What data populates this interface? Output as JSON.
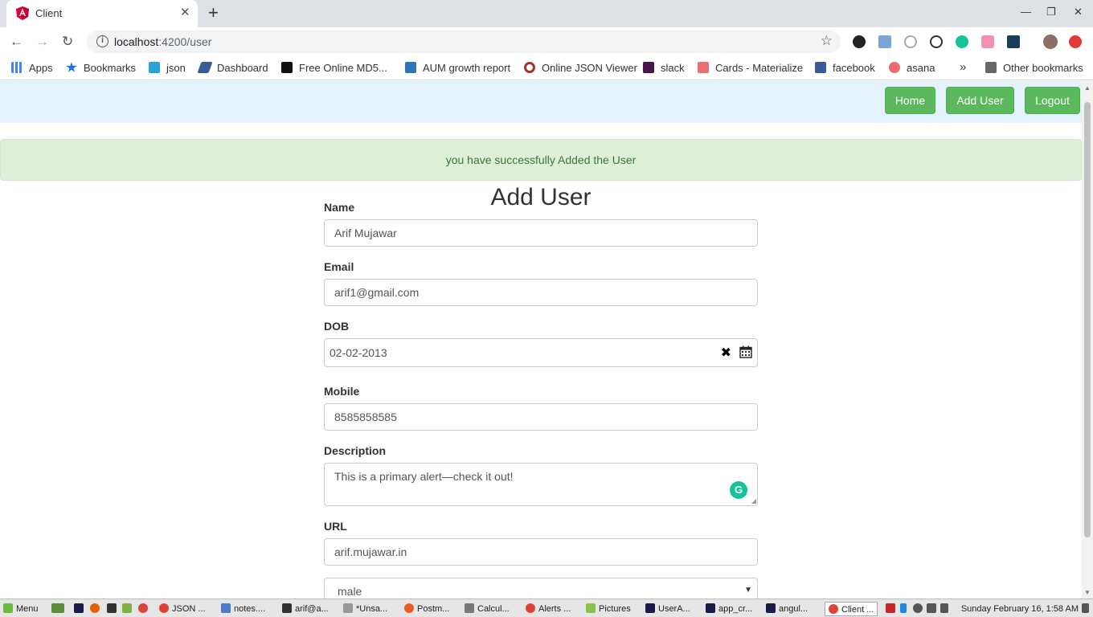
{
  "browser": {
    "tab_title": "Client",
    "tab_close": "✕",
    "new_tab": "+",
    "url_host": "localhost",
    "url_path": ":4200/user",
    "window_controls": {
      "minimize": "—",
      "restore": "❐",
      "close": "✕"
    },
    "nav": {
      "back": "←",
      "forward": "→",
      "reload": "↻"
    },
    "star": "☆",
    "bookmarks": [
      {
        "label": "Apps",
        "color": "#4285f4"
      },
      {
        "label": "Bookmarks",
        "color": "#1a73e8"
      },
      {
        "label": "json",
        "color": "#29a3d8"
      },
      {
        "label": "Dashboard",
        "color": "#3a5a9a"
      },
      {
        "label": "Free Online MD5...",
        "color": "#111111"
      },
      {
        "label": "AUM growth report",
        "color": "#2e75b6"
      },
      {
        "label": "Online JSON Viewer",
        "color": "#a33333"
      },
      {
        "label": "slack",
        "color": "#4a154b"
      },
      {
        "label": "Cards - Materialize",
        "color": "#ee6e73"
      },
      {
        "label": "facebook",
        "color": "#3b5998"
      },
      {
        "label": "asana",
        "color": "#f06a6a"
      }
    ],
    "bookmarks_more": "»",
    "other_bookmarks": "Other bookmarks"
  },
  "navbar": {
    "home": "Home",
    "add_user": "Add User",
    "logout": "Logout",
    "bg_color": "#e3f2fd",
    "button_color": "#5cb85c"
  },
  "alert": {
    "message": "you have successfully Added the User",
    "color": "#3c763d"
  },
  "form": {
    "title": "Add User",
    "name_label": "Name",
    "name_value": "Arif Mujawar",
    "email_label": "Email",
    "email_value": "arif1@gmail.com",
    "dob_label": "DOB",
    "dob_value": "02-02-2013",
    "dob_clear": "✖",
    "mobile_label": "Mobile",
    "mobile_value": "8585858585",
    "description_label": "Description",
    "description_value": "This is a primary alert—check it out!",
    "url_label": "URL",
    "url_value": "arif.mujawar.in",
    "gender_value": "male",
    "grammarly_glyph": "G"
  },
  "taskbar": {
    "menu": "Menu",
    "items": [
      "JSON ...",
      "notes....",
      "arif@a...",
      "*Unsa...",
      "Postm...",
      "Calcul...",
      "Alerts ...",
      "Pictures",
      "UserA...",
      "app_cr...",
      "angul...",
      "Client ..."
    ],
    "clock": "Sunday February 16,  1:58 AM"
  }
}
